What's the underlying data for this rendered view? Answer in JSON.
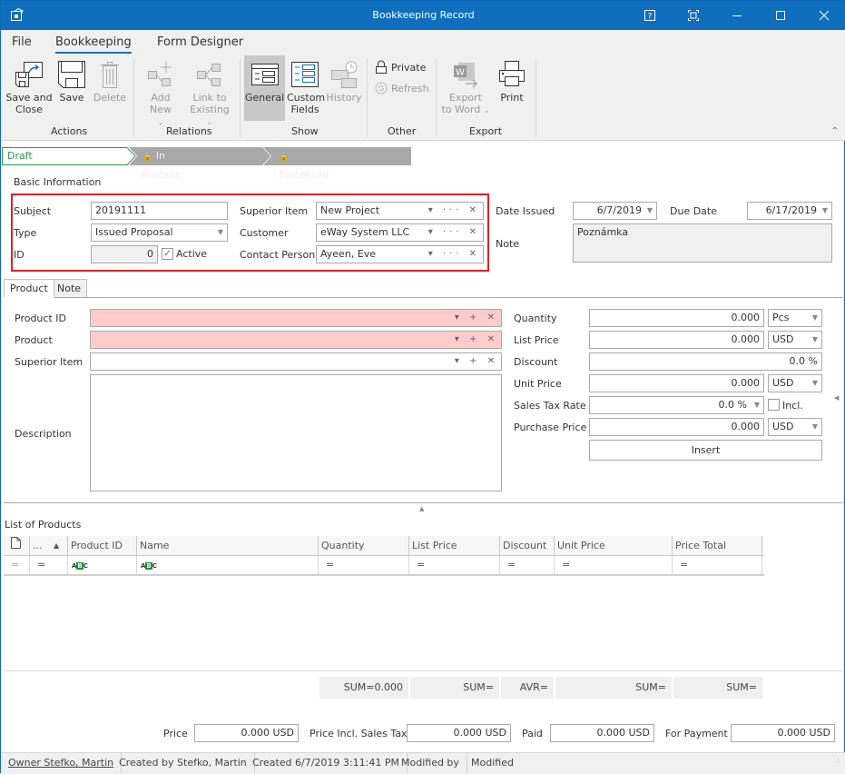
{
  "window": {
    "title": "Bookkeeping Record",
    "controls": [
      "help-icon",
      "fullscreen-icon",
      "minimize-icon",
      "maximize-icon",
      "close-icon"
    ]
  },
  "menu": {
    "items": [
      "File",
      "Bookkeeping",
      "Form Designer"
    ],
    "active": "Bookkeeping"
  },
  "ribbon": {
    "groups": [
      {
        "label": "Actions",
        "buttons": [
          "Save and\nClose",
          "Save",
          "Delete"
        ]
      },
      {
        "label": "Relations",
        "buttons": [
          "Add New",
          "Link to\nExisting"
        ]
      },
      {
        "label": "Show",
        "buttons": [
          "General",
          "Custom\nFields",
          "History"
        ]
      },
      {
        "label": "Other",
        "buttons": [
          "Private",
          "Refresh"
        ]
      },
      {
        "label": "Export",
        "buttons": [
          "Export\nto Word",
          "Print"
        ]
      }
    ],
    "save_close_1": "Save and",
    "save_close_2": "Close",
    "save": "Save",
    "delete": "Delete",
    "add_new": "Add New",
    "link_1": "Link to",
    "link_2": "Existing",
    "general": "General",
    "custom_1": "Custom",
    "custom_2": "Fields",
    "history": "History",
    "private": "Private",
    "refresh": "Refresh",
    "export_1": "Export",
    "export_2": "to Word",
    "print": "Print",
    "actions": "Actions",
    "relations": "Relations",
    "show": "Show",
    "other": "Other",
    "export": "Export"
  },
  "workflow": {
    "steps": [
      "Draft",
      "In Process",
      "Processed"
    ],
    "current": "Draft"
  },
  "basic": {
    "section": "Basic Information",
    "subject_label": "Subject",
    "subject": "20191111",
    "type_label": "Type",
    "type": "Issued Proposal",
    "id_label": "ID",
    "id": "0",
    "active_label": "Active",
    "active": true,
    "superior_label": "Superior Item",
    "superior": "New Project",
    "customer_label": "Customer",
    "customer": "eWay System LLC",
    "contact_label": "Contact Person",
    "contact": "Ayeen, Eve",
    "date_issued_label": "Date Issued",
    "date_issued": "6/7/2019",
    "due_date_label": "Due Date",
    "due_date": "6/17/2019",
    "note_label": "Note",
    "note": "Poznámka"
  },
  "tabs": [
    "Product",
    "Note"
  ],
  "product": {
    "product_id_label": "Product ID",
    "product_id": "",
    "product_label": "Product",
    "product": "",
    "superior_label": "Superior Item",
    "superior": "",
    "description_label": "Description",
    "description": "",
    "quantity_label": "Quantity",
    "quantity": "0.000",
    "quantity_unit": "Pcs",
    "list_price_label": "List Price",
    "list_price": "0.000",
    "list_price_cur": "USD",
    "discount_label": "Discount",
    "discount": "0.0 %",
    "unit_price_label": "Unit Price",
    "unit_price": "0.000",
    "unit_price_cur": "USD",
    "tax_label": "Sales Tax Rate",
    "tax": "0.0 %",
    "incl_label": "Incl.",
    "incl": false,
    "purchase_label": "Purchase Price",
    "purchase": "0.000",
    "purchase_cur": "USD",
    "insert": "Insert"
  },
  "list": {
    "title": "List of Products",
    "columns": [
      "...",
      "Product ID",
      "Name",
      "Quantity",
      "List Price",
      "Discount",
      "Unit Price",
      "Price Total"
    ],
    "filter_row": [
      "=",
      "=",
      "ABC",
      "ABC",
      "=",
      "=",
      "=",
      "=",
      "="
    ],
    "summaries": [
      "SUM=0.000",
      "SUM=",
      "AVR=",
      "SUM=",
      "SUM="
    ]
  },
  "totals": {
    "price_label": "Price",
    "price": "0.000 USD",
    "price_tax_label": "Price Incl. Sales Tax",
    "price_tax": "0.000 USD",
    "paid_label": "Paid",
    "paid": "0.000 USD",
    "for_payment_label": "For Payment",
    "for_payment": "0.000 USD"
  },
  "status": {
    "owner": "Owner Stefko, Martin",
    "created_by": "Created by Stefko, Martin",
    "created": "Created 6/7/2019 3:11:41 PM",
    "modified_by": "Modified by",
    "modified": "Modified"
  }
}
